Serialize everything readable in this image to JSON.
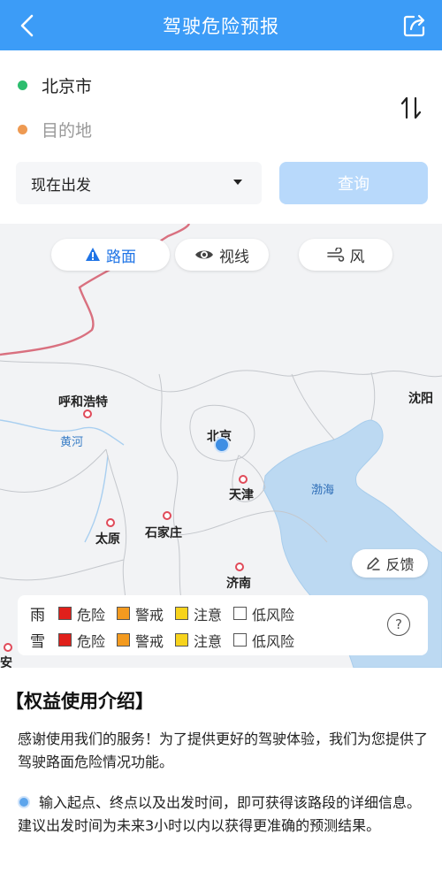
{
  "header": {
    "title": "驾驶危险预报",
    "back_icon": "chevron-left-icon",
    "share_icon": "share-icon",
    "color": "#3c9cf7"
  },
  "route": {
    "origin": "北京市",
    "origin_color": "#2dbd6e",
    "destination_placeholder": "目的地",
    "destination_color": "#ee9a52",
    "swap_icon": "swap-icon",
    "departure": "现在出发",
    "query_label": "查询"
  },
  "map": {
    "layers": {
      "road": "路面",
      "sight": "视线",
      "wind": "风"
    },
    "cities": {
      "hohhot": "呼和浩特",
      "beijing": "北京",
      "shenyang": "沈阳",
      "tianjin": "天津",
      "taiyuan": "太原",
      "shijiazhuang": "石家庄",
      "jinan": "济南",
      "xian": "西安"
    },
    "river": "黄河",
    "sea": "渤海",
    "feedback": "反馈",
    "legend": {
      "rain": "雨",
      "snow": "雪",
      "levels": [
        "危险",
        "警戒",
        "注意",
        "低风险"
      ],
      "colors": [
        "#e0201b",
        "#f39a1f",
        "#f7d31c",
        "#ffffff"
      ],
      "help": "?"
    }
  },
  "intro": {
    "title": "【权益使用介绍】",
    "p1": "感谢使用我们的服务！为了提供更好的驾驶体验，我们为您提供了驾驶路面危险情况功能。",
    "p2": "输入起点、终点以及出发时间，即可获得该路段的详细信息。建议出发时间为未来3小时以内以获得更准确的预测结果。"
  }
}
